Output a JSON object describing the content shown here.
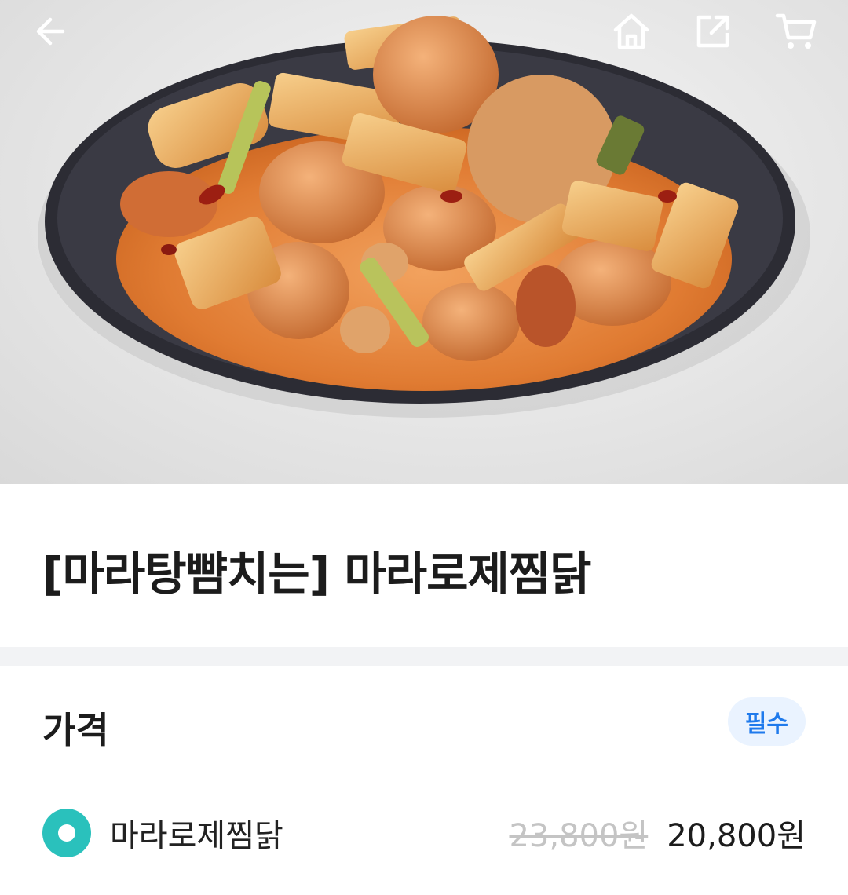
{
  "hero": {
    "image_alt": "마라로제찜닭 dish photo",
    "back_icon": "arrow-left-icon",
    "home_icon": "home-icon",
    "share_icon": "share-icon",
    "cart_icon": "cart-icon"
  },
  "product": {
    "title": "[마라탕뺨치는] 마라로제찜닭"
  },
  "price_section": {
    "title": "가격",
    "badge": "필수",
    "options": [
      {
        "name": "마라로제찜닭",
        "original_price": "23,800원",
        "price": "20,800원",
        "selected": true
      }
    ]
  },
  "colors": {
    "accent": "#2ac1bc",
    "badge_text": "#1f7aec",
    "badge_bg": "#eaf3ff",
    "divider": "#f2f3f5"
  }
}
